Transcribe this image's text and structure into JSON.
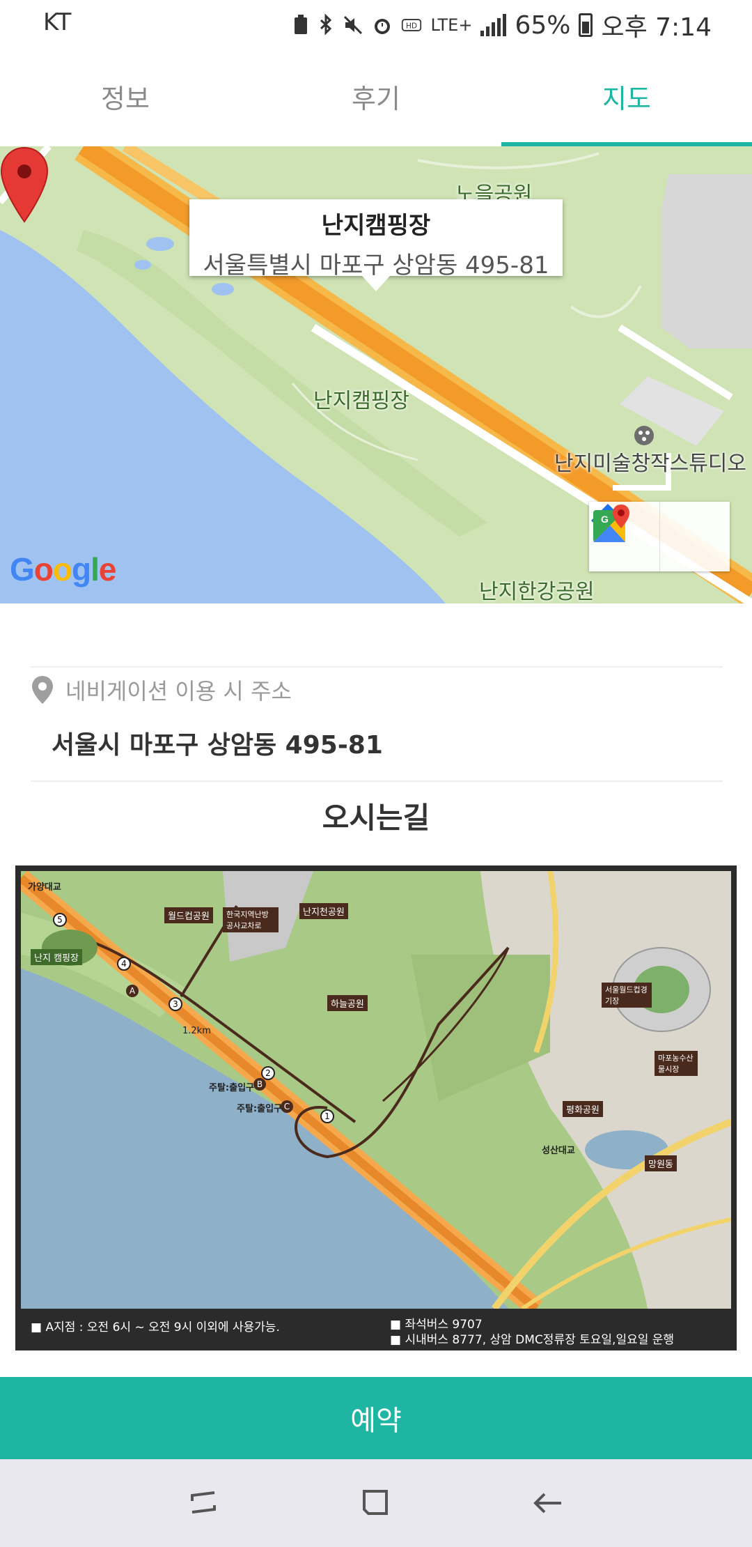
{
  "status_bar": {
    "carrier": "KT",
    "lte": "LTE+",
    "battery": "65%",
    "time": "오후 7:14"
  },
  "tabs": [
    {
      "label": "정보"
    },
    {
      "label": "후기"
    },
    {
      "label": "지도"
    }
  ],
  "map": {
    "info_title": "난지캠핑장",
    "info_address": "서울특별시 마포구 상암동 495-81",
    "labels": {
      "park_top": "노을공원",
      "camp": "난지캠핑장",
      "studio": "난지미술창작스튜디오",
      "hangang": "난지한강공원"
    },
    "google": "Google"
  },
  "address": {
    "label": "네비게이션 이용 시 주소",
    "value": "서울시 마포구 상암동 495-81"
  },
  "directions": {
    "title": "오시는길",
    "map_labels": {
      "gayang": "가양대교",
      "camp": "난지 캠핑장",
      "worldcup_park": "월드컵공원",
      "hangang_park": "한국지역난방공사교차로",
      "nanji_stream": "난지천공원",
      "haneul": "하늘공원",
      "stadium": "서울월드컵경기장",
      "market": "마포농수산물시장",
      "peace": "평화공원",
      "seongsan": "성산대교",
      "mangwon": "망원동",
      "entrance_b": "주탈:출입구",
      "entrance_c": "주탈:출입구",
      "distance": "1.2km"
    },
    "legend": {
      "left": "■  A지점 : 오전 6시 ~ 오전 9시 이외에 사용가능.",
      "right1": "■  좌석버스 9707",
      "right2": "■  시내버스 8777, 상암 DMC정류장 토요일,일요일 운행"
    }
  },
  "reserve_button": "예약",
  "colors": {
    "accent": "#1fb5a3",
    "tab_inactive": "#8a8a8a",
    "nav_bg": "#e8e8ee"
  }
}
